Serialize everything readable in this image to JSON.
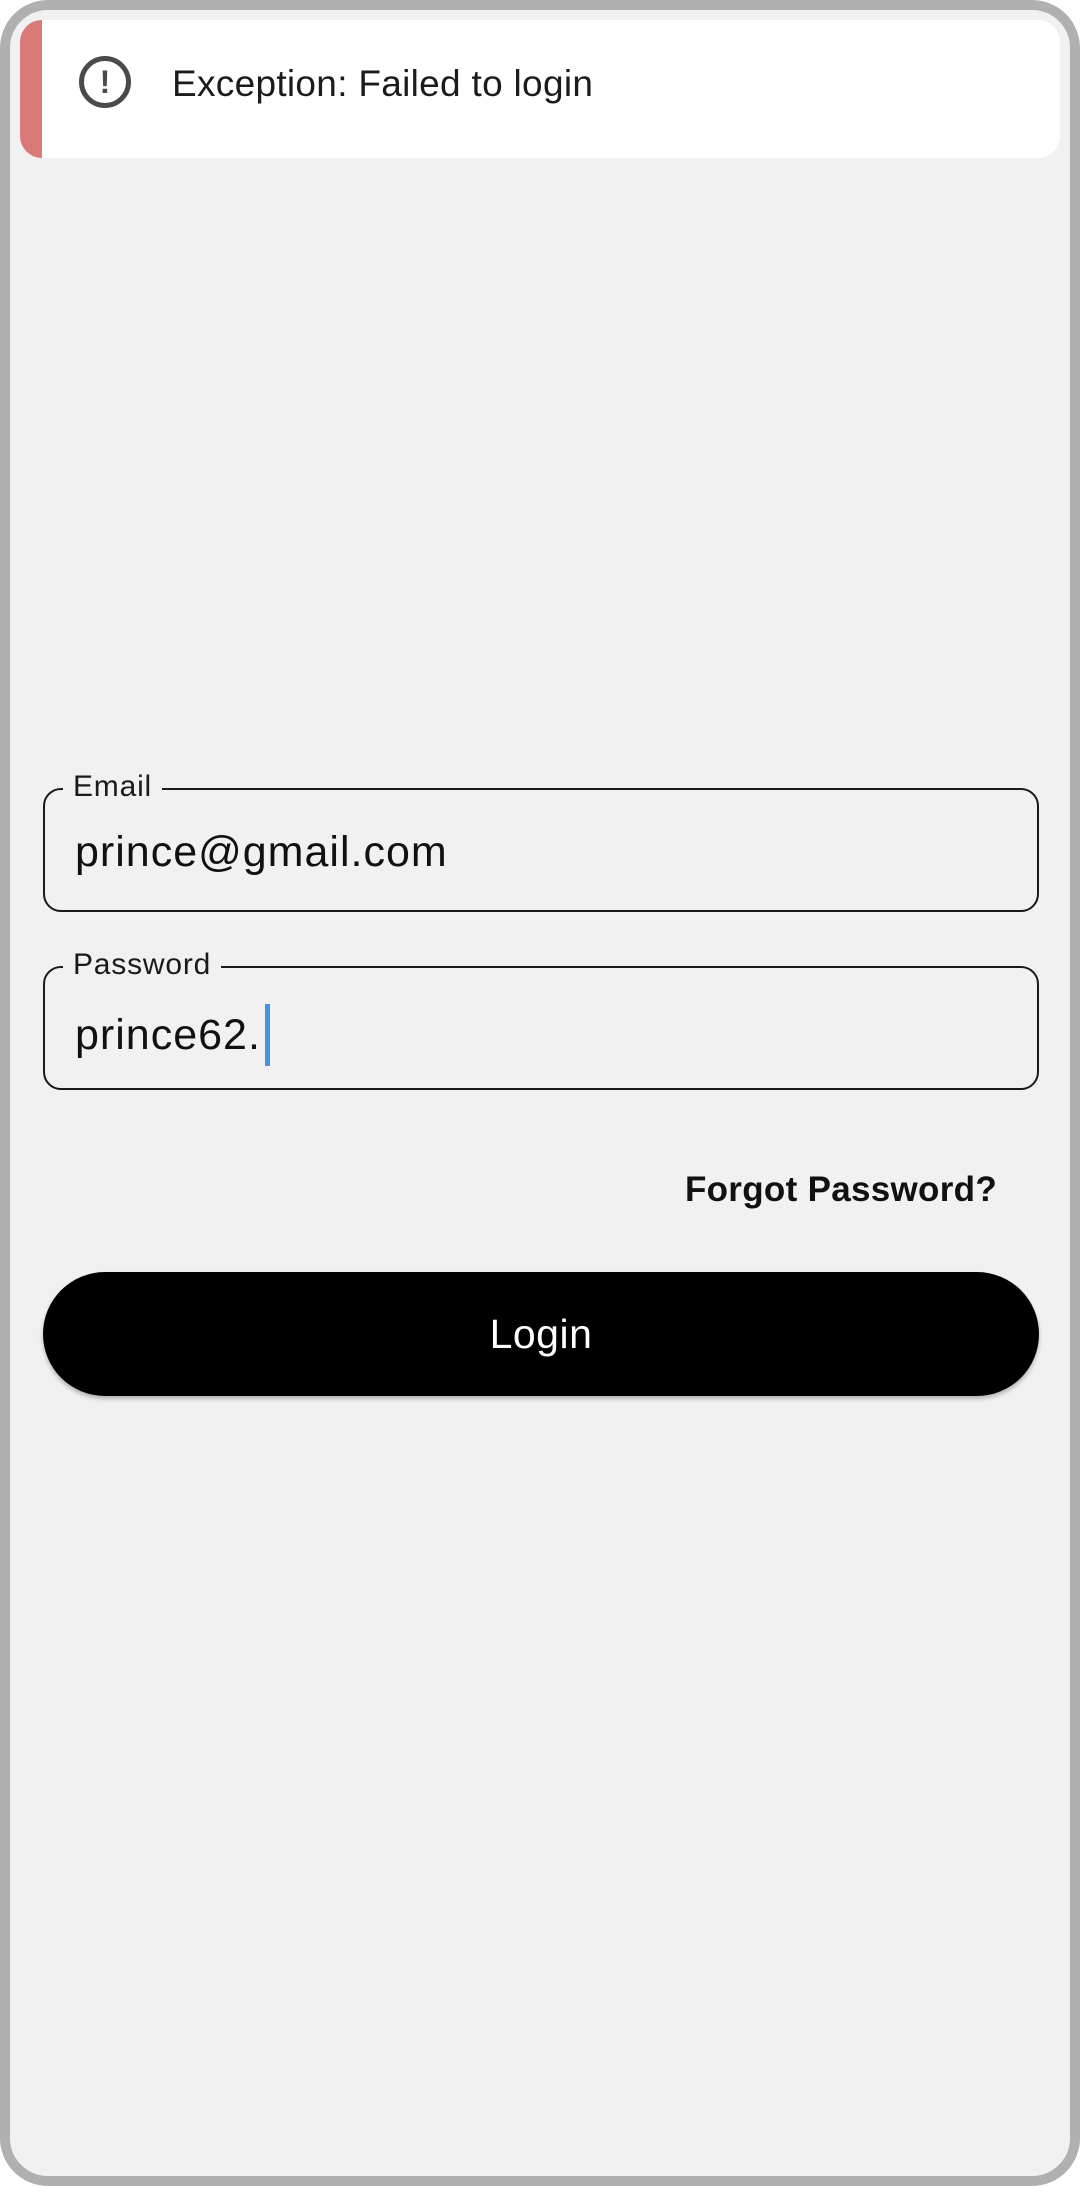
{
  "toast": {
    "icon": "error-exclamation-icon",
    "message": "Exception: Failed to login",
    "accent_color": "#d97a78"
  },
  "form": {
    "email": {
      "label": "Email",
      "value": "prince@gmail.com"
    },
    "password": {
      "label": "Password",
      "value": "prince62."
    },
    "forgot_password": "Forgot Password?",
    "login_label": "Login"
  },
  "colors": {
    "background": "#f1f1f1",
    "button": "#000000",
    "caret": "#4a90e2"
  }
}
